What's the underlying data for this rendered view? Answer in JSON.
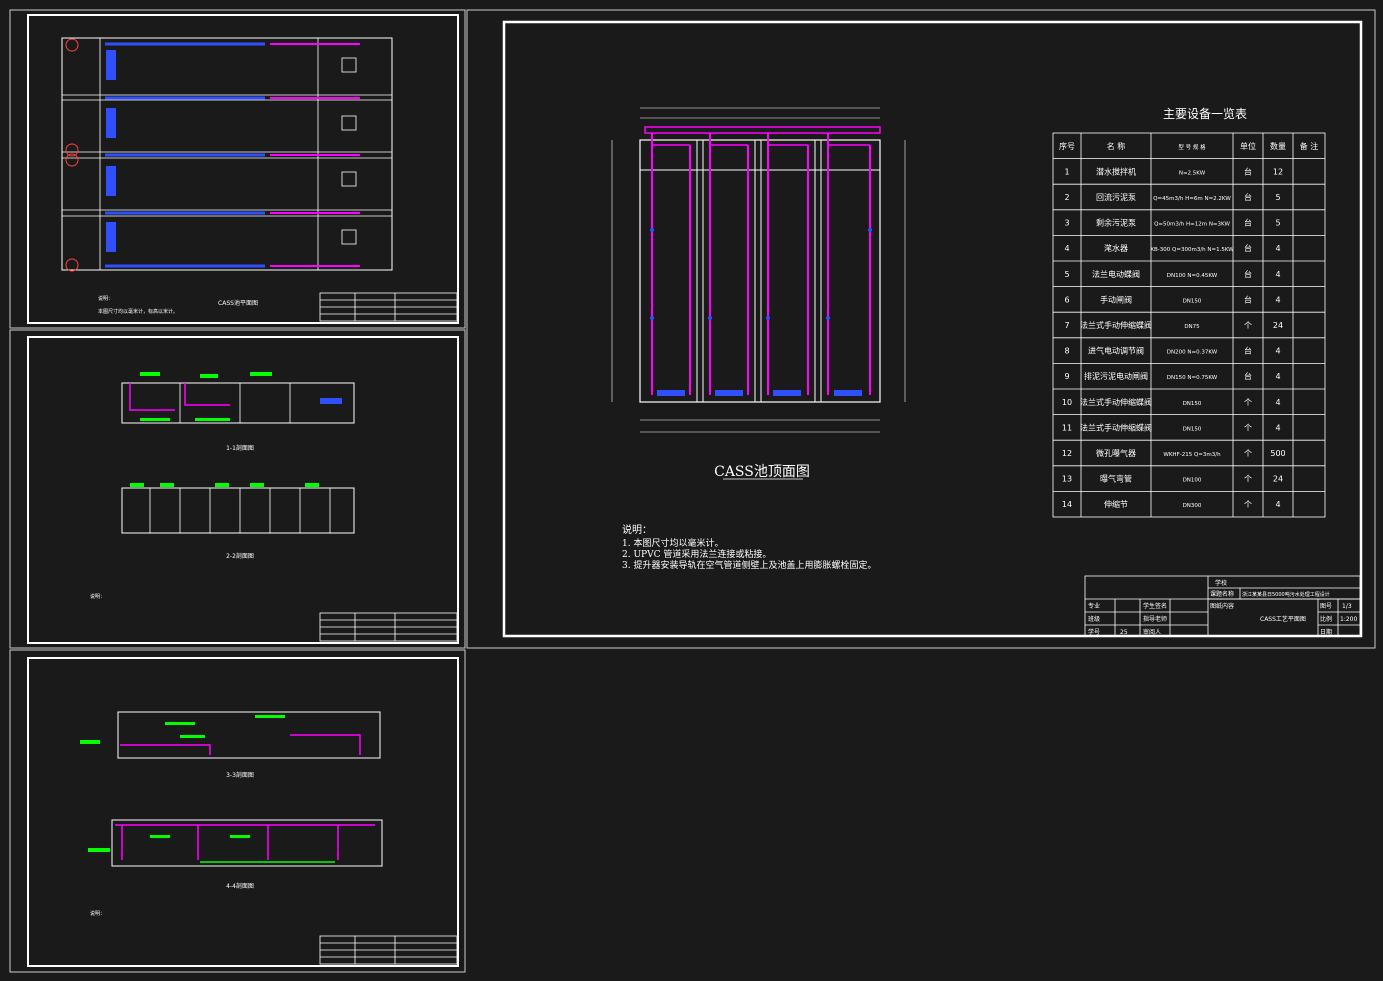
{
  "sheet1": {
    "title": "CASS池平面图",
    "notes": "说明：",
    "note_lines": [
      "本图尺寸均以毫米计，标高以米计。"
    ]
  },
  "sheet2": {
    "section_a": "1-1剖面图",
    "section_b": "2-2剖面图",
    "notes": "说明："
  },
  "sheet3": {
    "section_a": "3-3剖面图",
    "section_b": "4-4剖面图",
    "notes": "说明："
  },
  "sheet4": {
    "plan_title": "CASS池顶面图",
    "equipment_table_title": "主要设备一览表",
    "table_headers": [
      "序号",
      "名 称",
      "型 号 规 格",
      "单位",
      "数量",
      "备 注"
    ],
    "table_rows": [
      [
        "1",
        "潜水搅拌机",
        "N=2.5KW",
        "台",
        "12",
        ""
      ],
      [
        "2",
        "回流污泥泵",
        "Q=45m3/h H=6m N=2.2KW",
        "台",
        "5",
        ""
      ],
      [
        "3",
        "剩余污泥泵",
        "Q=50m3/h H=12m N=3KW",
        "台",
        "5",
        ""
      ],
      [
        "4",
        "滗水器",
        "XB-300 Q=300m3/h N=1.5KW",
        "台",
        "4",
        ""
      ],
      [
        "5",
        "法兰电动蝶阀",
        "DN100 N=0.45KW",
        "台",
        "4",
        ""
      ],
      [
        "6",
        "手动闸阀",
        "DN150",
        "台",
        "4",
        ""
      ],
      [
        "7",
        "法兰式手动伸缩蝶阀",
        "DN75",
        "个",
        "24",
        ""
      ],
      [
        "8",
        "进气电动调节阀",
        "DN200 N=0.37KW",
        "台",
        "4",
        ""
      ],
      [
        "9",
        "排泥污泥电动闸阀",
        "DN150 N=0.75KW",
        "台",
        "4",
        ""
      ],
      [
        "10",
        "法兰式手动伸缩蝶阀",
        "DN150",
        "个",
        "4",
        ""
      ],
      [
        "11",
        "法兰式手动伸缩蝶阀",
        "DN150",
        "个",
        "4",
        ""
      ],
      [
        "12",
        "微孔曝气器",
        "WKHF-215 Q=3m3/h",
        "个",
        "500",
        ""
      ],
      [
        "13",
        "曝气弯管",
        "DN100",
        "个",
        "24",
        ""
      ],
      [
        "14",
        "伸缩节",
        "DN300",
        "个",
        "4",
        ""
      ]
    ],
    "notes_title": "说明：",
    "notes": [
      "1. 本图尺寸均以毫米计。",
      "2. UPVC  管道采用法兰连接或粘接。",
      "3. 提升器安装导轨在空气管道侧壁上及池盖上用膨胀螺栓固定。"
    ],
    "title_block": {
      "school": "学校",
      "project_label": "课题名称",
      "project": "浙江某某县日5000吨污水处理工程设计",
      "content_label": "图纸内容",
      "content": "CASS工艺平面图",
      "major": "专业",
      "class": "班级",
      "student_no": "学号",
      "student_no_val": "25",
      "student_sign": "学生签名",
      "advisor_sign": "指导老师",
      "reviewer": "审阅人",
      "fig_no": "图号",
      "fig_no_val": "1/3",
      "scale": "比例",
      "scale_val": "1:200",
      "date": "日期"
    }
  },
  "colors": {
    "background": "#1a1a1a",
    "frame": "#ffffff",
    "pipe_air": "#ff00ff",
    "pipe_water": "#0000ff",
    "annotation": "#00ff00"
  }
}
